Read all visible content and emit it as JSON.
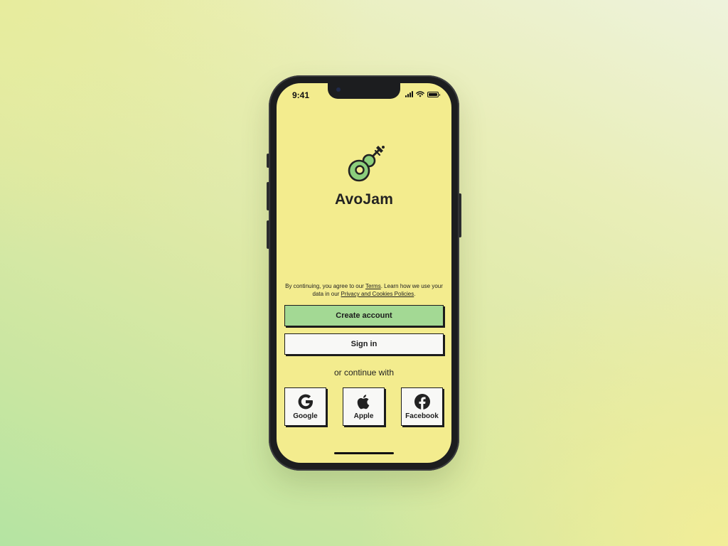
{
  "status_bar": {
    "time": "9:41"
  },
  "app": {
    "name": "AvoJam",
    "logo_icon": "guitar-icon"
  },
  "legal": {
    "prefix": "By continuing, you agree to our ",
    "terms_link": "Terms",
    "middle": ". Learn how we use your data in our ",
    "privacy_link": "Privacy and Cookies Policies",
    "suffix": "."
  },
  "buttons": {
    "create_account": "Create account",
    "sign_in": "Sign in"
  },
  "divider_text": "or continue with",
  "social": {
    "google": {
      "label": "Google",
      "icon": "google-icon"
    },
    "apple": {
      "label": "Apple",
      "icon": "apple-icon"
    },
    "facebook": {
      "label": "Facebook",
      "icon": "facebook-icon"
    }
  },
  "colors": {
    "screen_bg": "#f3ec8e",
    "primary_button": "#a3d994",
    "secondary_button": "#f8f8f6",
    "ink": "#1c1c1c"
  }
}
